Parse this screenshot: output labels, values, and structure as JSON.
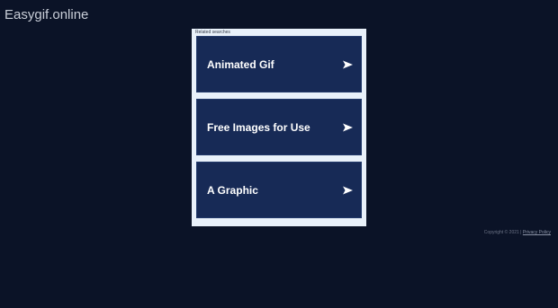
{
  "header": {
    "site_title": "Easygif.online"
  },
  "related": {
    "header_label": "Related searches",
    "items": [
      {
        "label": "Animated Gif",
        "icon": "arrow-right-icon"
      },
      {
        "label": "Free Images for Use",
        "icon": "arrow-right-icon"
      },
      {
        "label": "A Graphic",
        "icon": "arrow-right-icon"
      }
    ]
  },
  "footer": {
    "copyright": "Copyright © 2021 |",
    "privacy_link": "Privacy Policy"
  },
  "colors": {
    "background": "#0b1327",
    "panel": "#e9f1fa",
    "item_background": "#172a56",
    "item_text": "#ffffff"
  }
}
